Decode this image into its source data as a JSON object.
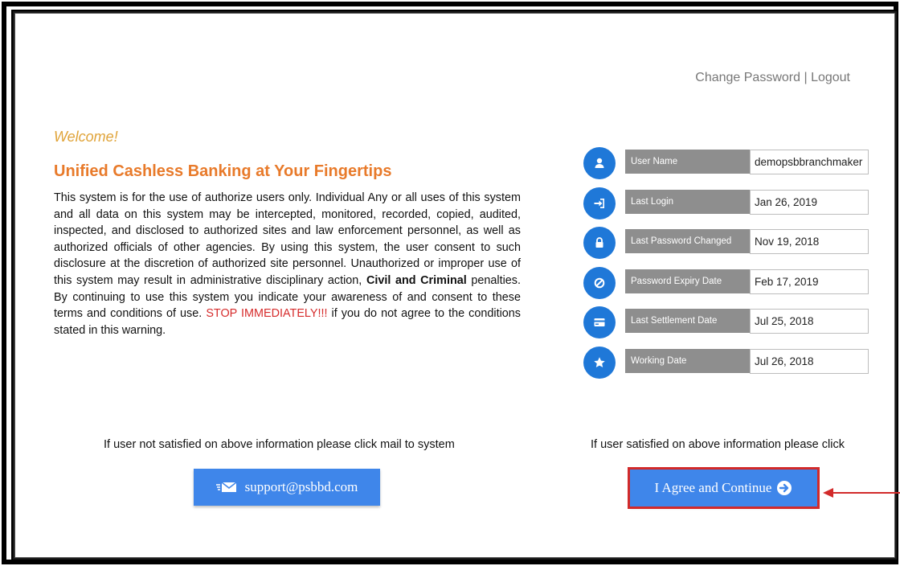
{
  "header": {
    "change_password": "Change Password",
    "separator": " | ",
    "logout": "Logout"
  },
  "welcome": "Welcome!",
  "headline": "Unified Cashless Banking at Your Fingertips",
  "terms": {
    "part1": "This system is for the use of authorize users only. Individual Any or all uses of this system and all data on this system may be intercepted, monitored, recorded, copied, audited, inspected, and disclosed to authorized sites and law enforcement personnel, as well as authorized officials of other agencies. By using this system, the user consent to such disclosure at the discretion of authorized site personnel. Unauthorized or improper use of this system may result in administrative disciplinary action, ",
    "bold": "Civil and Criminal",
    "part2": " penalties. By continuing to use this system you indicate your awareness of and consent to these terms and conditions of use. ",
    "stop": "STOP IMMEDIATELY!!!",
    "part3": " if you do not agree to the conditions stated in this warning."
  },
  "info": [
    {
      "icon": "user-icon",
      "label": "User Name",
      "value": "demopsbbranchmaker"
    },
    {
      "icon": "sign-in-icon",
      "label": "Last Login",
      "value": "Jan 26, 2019"
    },
    {
      "icon": "lock-icon",
      "label": "Last Password Changed",
      "value": "Nov 19, 2018"
    },
    {
      "icon": "ban-icon",
      "label": "Password Expiry Date",
      "value": "Feb 17, 2019"
    },
    {
      "icon": "card-icon",
      "label": "Last Settlement Date",
      "value": "Jul 25, 2018"
    },
    {
      "icon": "star-icon",
      "label": "Working Date",
      "value": "Jul 26, 2018"
    }
  ],
  "notes": {
    "left": "If user not satisfied on above information please click mail to system",
    "right": "If user satisfied on above information please click"
  },
  "buttons": {
    "mail": "support@psbbd.com",
    "agree": "I Agree and Continue"
  },
  "colors": {
    "accent_blue": "#3f86ea",
    "icon_blue": "#1f78d8",
    "label_gray": "#8e8e8e",
    "welcome": "#e0a43a",
    "headline": "#e87a2a",
    "stop_red": "#d62c2c",
    "highlight_red": "#d22a2a"
  }
}
